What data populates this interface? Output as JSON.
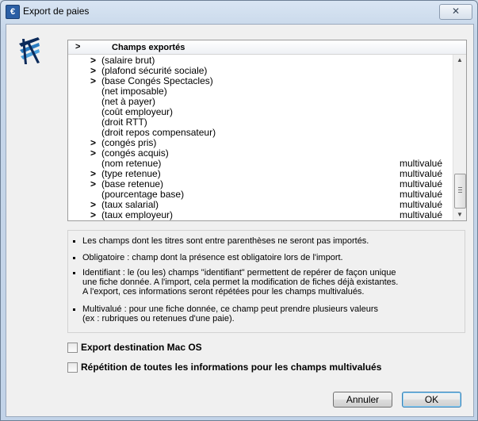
{
  "window": {
    "title": "Export de paies",
    "close_glyph": "✕",
    "app_icon": "€"
  },
  "list": {
    "header_arrow": ">",
    "header_label": "Champs exportés",
    "rows": [
      {
        "arrow": ">",
        "label": "(salaire brut)",
        "multi": ""
      },
      {
        "arrow": ">",
        "label": "(plafond sécurité sociale)",
        "multi": ""
      },
      {
        "arrow": ">",
        "label": "(base Congés Spectacles)",
        "multi": ""
      },
      {
        "arrow": "",
        "label": "(net imposable)",
        "multi": ""
      },
      {
        "arrow": "",
        "label": "(net à payer)",
        "multi": ""
      },
      {
        "arrow": "",
        "label": "(coût employeur)",
        "multi": ""
      },
      {
        "arrow": "",
        "label": "(droit RTT)",
        "multi": ""
      },
      {
        "arrow": "",
        "label": "(droit repos compensateur)",
        "multi": ""
      },
      {
        "arrow": ">",
        "label": "(congés pris)",
        "multi": ""
      },
      {
        "arrow": ">",
        "label": "(congés acquis)",
        "multi": ""
      },
      {
        "arrow": "",
        "label": "(nom retenue)",
        "multi": "multivalué"
      },
      {
        "arrow": ">",
        "label": "(type retenue)",
        "multi": "multivalué"
      },
      {
        "arrow": ">",
        "label": "(base retenue)",
        "multi": "multivalué"
      },
      {
        "arrow": "",
        "label": "(pourcentage base)",
        "multi": "multivalué"
      },
      {
        "arrow": ">",
        "label": "(taux salarial)",
        "multi": "multivalué"
      },
      {
        "arrow": ">",
        "label": "(taux employeur)",
        "multi": "multivalué"
      }
    ]
  },
  "notes": [
    "Les champs dont les titres sont entre parenthèses ne seront pas importés.",
    "Obligatoire : champ dont la présence est obligatoire lors de l'import.",
    "Identifiant : le (ou les) champs \"identifiant\" permettent de repérer de façon unique\nune fiche donnée. A l'import, cela permet la modification de fiches déjà existantes.\nA l'export, ces informations seront répétées pour les champs multivalués.",
    "Multivalué : pour une fiche donnée, ce champ peut prendre plusieurs valeurs\n(ex : rubriques ou retenues d'une paie)."
  ],
  "options": {
    "mac_os_label": "Export destination Mac OS",
    "mac_os_checked": false,
    "repeat_label": "Répétition de toutes les informations pour les champs multivalués",
    "repeat_checked": false
  },
  "buttons": {
    "cancel": "Annuler",
    "ok": "OK"
  },
  "colors": {
    "logo_blue": "#2a7bc0",
    "logo_dark": "#0b2a5a"
  }
}
